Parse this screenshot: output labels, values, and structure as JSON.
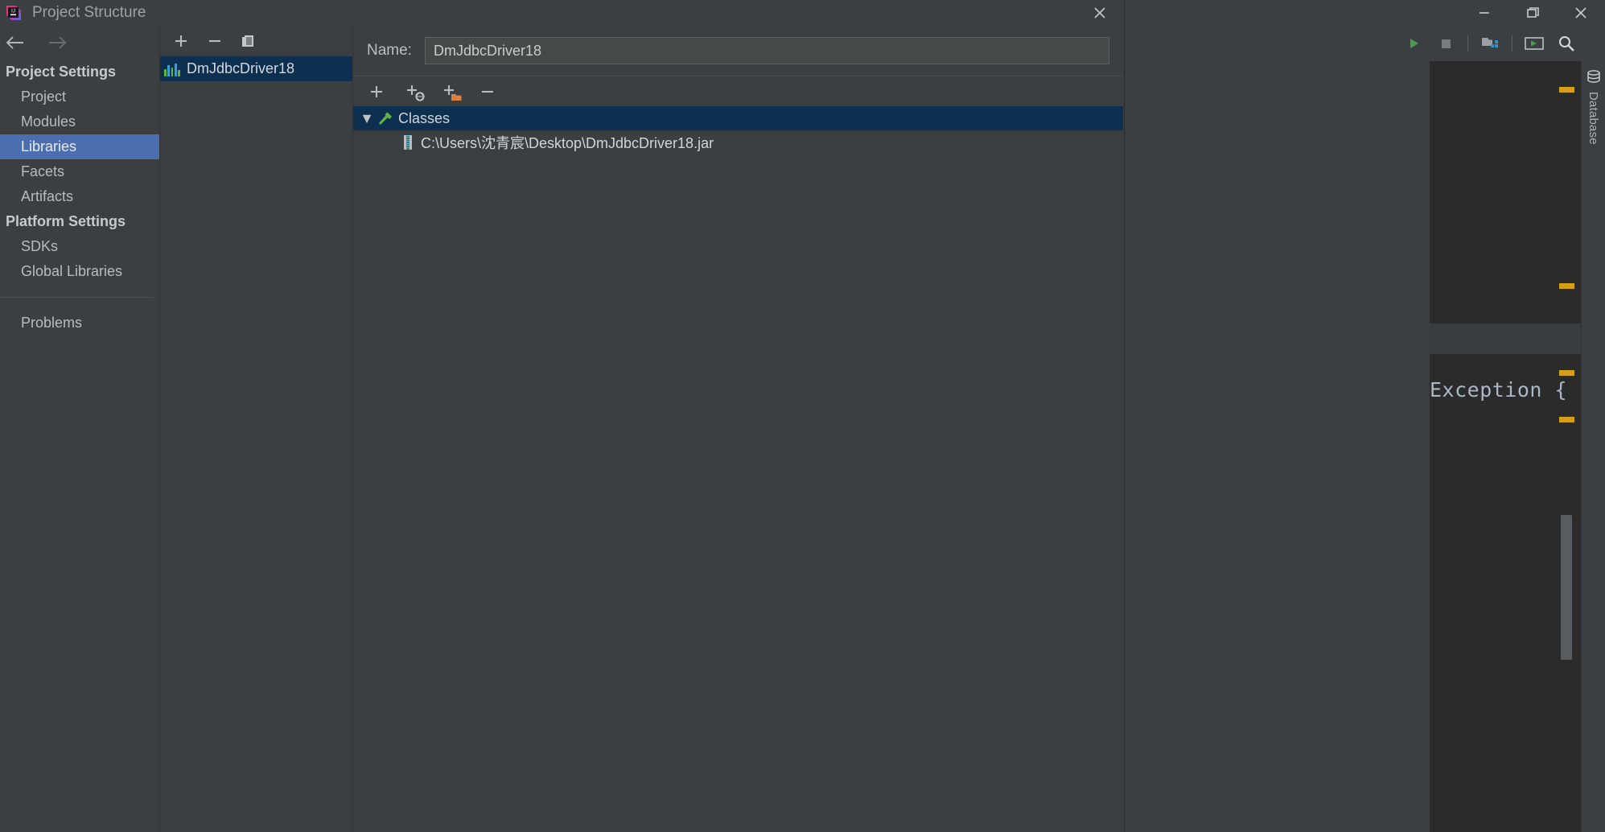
{
  "ide": {
    "window_controls": {
      "minimize": "minimize-icon",
      "maximize": "maximize-icon",
      "close": "close-icon"
    },
    "toolbar_icons": [
      "run-icon",
      "stop-icon",
      "project-structure-icon",
      "run-configuration-icon",
      "search-icon"
    ],
    "editor": {
      "code_fragment": "Exception {",
      "gutter_marker_color": "#d4a017"
    },
    "tool_window": {
      "label": "Database",
      "icon": "database-icon"
    }
  },
  "dialog": {
    "title": "Project Structure",
    "app_icon": "intellij-idea-icon",
    "close_label": "close-icon",
    "nav": {
      "back": "arrow-left-icon",
      "forward": "arrow-right-icon"
    },
    "sidebar": {
      "groups": [
        {
          "label": "Project Settings",
          "items": [
            {
              "label": "Project",
              "selected": false
            },
            {
              "label": "Modules",
              "selected": false
            },
            {
              "label": "Libraries",
              "selected": true
            },
            {
              "label": "Facets",
              "selected": false
            },
            {
              "label": "Artifacts",
              "selected": false
            }
          ]
        },
        {
          "label": "Platform Settings",
          "items": [
            {
              "label": "SDKs",
              "selected": false
            },
            {
              "label": "Global Libraries",
              "selected": false
            }
          ]
        }
      ],
      "footer_items": [
        {
          "label": "Problems",
          "selected": false
        }
      ]
    },
    "library_list": {
      "toolbar": [
        {
          "name": "add-library-button",
          "glyph": "+"
        },
        {
          "name": "remove-library-button",
          "glyph": "−"
        },
        {
          "name": "copy-library-button",
          "glyph": "copy-icon"
        }
      ],
      "items": [
        {
          "label": "DmJdbcDriver18",
          "icon": "library-icon",
          "selected": true
        }
      ]
    },
    "detail": {
      "name_label": "Name:",
      "name_value": "DmJdbcDriver18",
      "roots_toolbar": [
        {
          "name": "add-root-button",
          "glyph": "+",
          "badge": "none"
        },
        {
          "name": "add-from-maven-button",
          "glyph": "+",
          "badge": "globe"
        },
        {
          "name": "add-from-directory-button",
          "glyph": "+",
          "badge": "folder"
        },
        {
          "name": "remove-root-button",
          "glyph": "−",
          "badge": "none"
        }
      ],
      "tree": [
        {
          "label": "Classes",
          "icon": "hammer-icon",
          "expanded": true,
          "selected": true,
          "caret": "▼",
          "children": [
            {
              "label": "C:\\Users\\沈青宸\\Desktop\\DmJdbcDriver18.jar",
              "icon": "jar-icon"
            }
          ]
        }
      ]
    }
  },
  "colors": {
    "selection_blue": "#4b6eaf",
    "tree_selection": "#0d2f50",
    "panel_bg": "#3c3f41",
    "editor_bg": "#2b2b2b",
    "accent_orange": "#cc7832"
  }
}
